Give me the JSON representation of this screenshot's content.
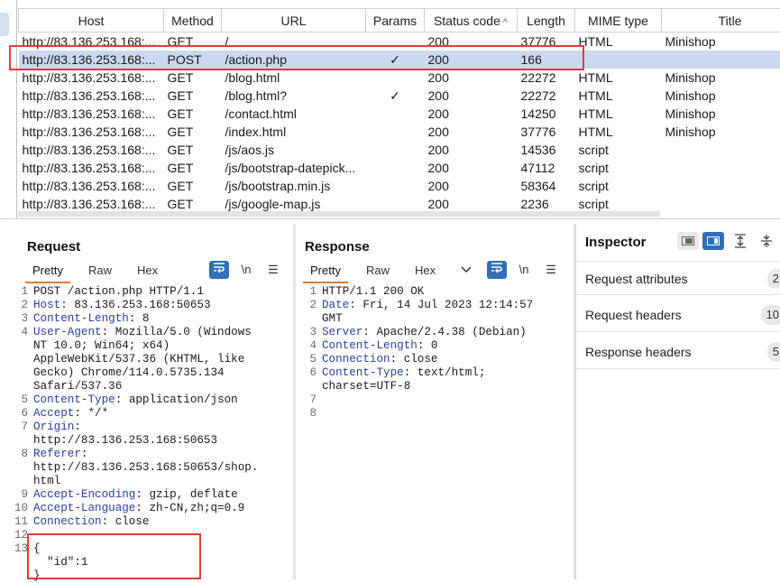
{
  "history": {
    "columns": [
      "Host",
      "Method",
      "URL",
      "Params",
      "Status code",
      "Length",
      "MIME type",
      "Title"
    ],
    "sort_indicator": "^",
    "rows": [
      {
        "host": "http://83.136.253.168:...",
        "method": "GET",
        "url": "/",
        "params": "",
        "status": "200",
        "length": "37776",
        "mime": "HTML",
        "title": "Minishop",
        "selected": false
      },
      {
        "host": "http://83.136.253.168:...",
        "method": "POST",
        "url": "/action.php",
        "params": "✓",
        "status": "200",
        "length": "166",
        "mime": "",
        "title": "",
        "selected": true
      },
      {
        "host": "http://83.136.253.168:...",
        "method": "GET",
        "url": "/blog.html",
        "params": "",
        "status": "200",
        "length": "22272",
        "mime": "HTML",
        "title": "Minishop",
        "selected": false
      },
      {
        "host": "http://83.136.253.168:...",
        "method": "GET",
        "url": "/blog.html?",
        "params": "✓",
        "status": "200",
        "length": "22272",
        "mime": "HTML",
        "title": "Minishop",
        "selected": false
      },
      {
        "host": "http://83.136.253.168:...",
        "method": "GET",
        "url": "/contact.html",
        "params": "",
        "status": "200",
        "length": "14250",
        "mime": "HTML",
        "title": "Minishop",
        "selected": false
      },
      {
        "host": "http://83.136.253.168:...",
        "method": "GET",
        "url": "/index.html",
        "params": "",
        "status": "200",
        "length": "37776",
        "mime": "HTML",
        "title": "Minishop",
        "selected": false
      },
      {
        "host": "http://83.136.253.168:...",
        "method": "GET",
        "url": "/js/aos.js",
        "params": "",
        "status": "200",
        "length": "14536",
        "mime": "script",
        "title": "",
        "selected": false
      },
      {
        "host": "http://83.136.253.168:...",
        "method": "GET",
        "url": "/js/bootstrap-datepick...",
        "params": "",
        "status": "200",
        "length": "47112",
        "mime": "script",
        "title": "",
        "selected": false
      },
      {
        "host": "http://83.136.253.168:...",
        "method": "GET",
        "url": "/js/bootstrap.min.js",
        "params": "",
        "status": "200",
        "length": "58364",
        "mime": "script",
        "title": "",
        "selected": false
      },
      {
        "host": "http://83.136.253.168:...",
        "method": "GET",
        "url": "/js/google-map.js",
        "params": "",
        "status": "200",
        "length": "2236",
        "mime": "script",
        "title": "",
        "selected": false
      }
    ]
  },
  "request": {
    "title": "Request",
    "tabs": [
      "Pretty",
      "Raw",
      "Hex"
    ],
    "newline_label": "\\n",
    "lines": [
      {
        "n": "1",
        "header": "",
        "text": "POST /action.php HTTP/1.1"
      },
      {
        "n": "2",
        "header": "Host",
        "text": ": 83.136.253.168:50653"
      },
      {
        "n": "3",
        "header": "Content-Length",
        "text": ": 8"
      },
      {
        "n": "4",
        "header": "User-Agent",
        "text": ": Mozilla/5.0 (Windows"
      },
      {
        "n": "",
        "header": "",
        "text": "NT 10.0; Win64; x64)"
      },
      {
        "n": "",
        "header": "",
        "text": "AppleWebKit/537.36 (KHTML, like"
      },
      {
        "n": "",
        "header": "",
        "text": "Gecko) Chrome/114.0.5735.134"
      },
      {
        "n": "",
        "header": "",
        "text": "Safari/537.36"
      },
      {
        "n": "5",
        "header": "Content-Type",
        "text": ": application/json"
      },
      {
        "n": "6",
        "header": "Accept",
        "text": ": */*"
      },
      {
        "n": "7",
        "header": "Origin",
        "text": ":"
      },
      {
        "n": "",
        "header": "",
        "text": "http://83.136.253.168:50653"
      },
      {
        "n": "8",
        "header": "Referer",
        "text": ":"
      },
      {
        "n": "",
        "header": "",
        "text": "http://83.136.253.168:50653/shop."
      },
      {
        "n": "",
        "header": "",
        "text": "html"
      },
      {
        "n": "9",
        "header": "Accept-Encoding",
        "text": ": gzip, deflate"
      },
      {
        "n": "10",
        "header": "Accept-Language",
        "text": ": zh-CN,zh;q=0.9"
      },
      {
        "n": "11",
        "header": "Connection",
        "text": ": close"
      },
      {
        "n": "12",
        "header": "",
        "text": ""
      },
      {
        "n": "13",
        "header": "",
        "text": "{"
      },
      {
        "n": "",
        "header": "",
        "text": "  \"id\":1"
      },
      {
        "n": "",
        "header": "",
        "text": "}"
      }
    ]
  },
  "response": {
    "title": "Response",
    "tabs": [
      "Pretty",
      "Raw",
      "Hex"
    ],
    "newline_label": "\\n",
    "lines": [
      {
        "n": "1",
        "header": "",
        "text": "HTTP/1.1 200 OK"
      },
      {
        "n": "2",
        "header": "Date",
        "text": ": Fri, 14 Jul 2023 12:14:57"
      },
      {
        "n": "",
        "header": "",
        "text": "GMT"
      },
      {
        "n": "3",
        "header": "Server",
        "text": ": Apache/2.4.38 (Debian)"
      },
      {
        "n": "4",
        "header": "Content-Length",
        "text": ": 0"
      },
      {
        "n": "5",
        "header": "Connection",
        "text": ": close"
      },
      {
        "n": "6",
        "header": "Content-Type",
        "text": ": text/html;"
      },
      {
        "n": "",
        "header": "",
        "text": "charset=UTF-8"
      },
      {
        "n": "7",
        "header": "",
        "text": ""
      },
      {
        "n": "8",
        "header": "",
        "text": ""
      }
    ]
  },
  "inspector": {
    "title": "Inspector",
    "sections": [
      {
        "label": "Request attributes",
        "count": "2"
      },
      {
        "label": "Request headers",
        "count": "10"
      },
      {
        "label": "Response headers",
        "count": "5"
      }
    ]
  },
  "colors": {
    "accent": "#2f6fb8",
    "highlight": "#e03c3c",
    "selected_row": "#c9d9ef",
    "header_key": "#2a3f9b",
    "tab_underline": "#e07c2c"
  }
}
